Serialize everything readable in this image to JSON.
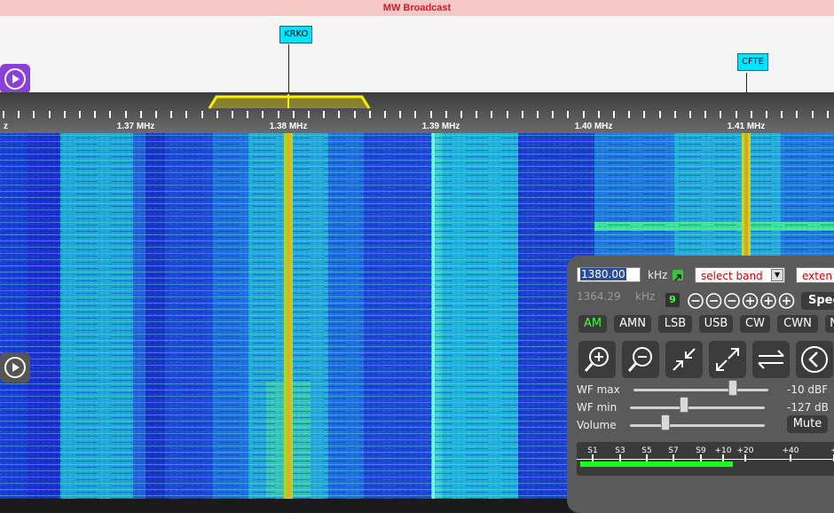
{
  "band": {
    "title": "MW Broadcast"
  },
  "stations": [
    {
      "name": "KRKO"
    },
    {
      "name": "CFTE"
    }
  ],
  "scale": {
    "edge_label": "z",
    "labels": [
      "1.37 MHz",
      "1.38 MHz",
      "1.39 MHz",
      "1.40 MHz",
      "1.41 MHz"
    ]
  },
  "panel": {
    "frequency_value": "1380.00",
    "frequency_unit": "kHz",
    "select_band": "select band",
    "extension": "exten",
    "cursor_freq": "1364.29",
    "cursor_unit": "kHz",
    "step_badge": "9",
    "spectrum_btn": "Spec",
    "modes": [
      "AM",
      "AMN",
      "LSB",
      "USB",
      "CW",
      "CWN",
      "N"
    ],
    "active_mode": "AM",
    "wf_max_label": "WF max",
    "wf_max_value": "-10 dBF",
    "wf_min_label": "WF min",
    "wf_min_value": "-127 dB",
    "volume_label": "Volume",
    "mute_label": "Mute",
    "smeter_labels": [
      "S1",
      "S3",
      "S5",
      "S7",
      "S9",
      "+10",
      "+20",
      "+40",
      "+"
    ],
    "slider_levels": {
      "wf_max": 0.74,
      "wf_min": 0.4,
      "volume": 0.26
    },
    "smeter_level": 0.66
  },
  "icons": [
    "play-icon",
    "zoom-in-icon",
    "zoom-out-icon",
    "collapse-icon",
    "expand-icon",
    "swap-icon",
    "back-icon",
    "popout-icon",
    "minus-icon",
    "plus-icon"
  ],
  "colors": {
    "band_bg": "#f6c8c8",
    "band_text": "#e0141e",
    "station_tag": "#00e5ff",
    "passband": "#ffee00",
    "active_mode": "#39ff39"
  }
}
